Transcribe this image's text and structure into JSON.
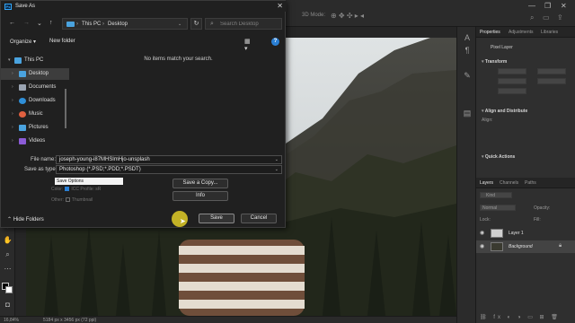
{
  "dialog": {
    "title": "Save As",
    "close_glyph": "✕",
    "nav": {
      "back": "←",
      "forward": "→",
      "recent": "⌄",
      "up": "↑",
      "refresh": "↻"
    },
    "breadcrumb": [
      "This PC",
      "Desktop"
    ],
    "breadcrumb_sep": "›",
    "search_placeholder": "Search Desktop",
    "toolbar": {
      "organize": "Organize ▾",
      "new_folder": "New folder",
      "view_glyph": "▦ ▾",
      "help_glyph": "?"
    },
    "tree": [
      {
        "label": "This PC",
        "expanded": true,
        "color": "#4aa3df"
      },
      {
        "label": "Desktop",
        "selected": true,
        "color": "#4aa3df"
      },
      {
        "label": "Documents",
        "color": "#9aa4b2"
      },
      {
        "label": "Downloads",
        "color": "#2f8fd8"
      },
      {
        "label": "Music",
        "color": "#e06040"
      },
      {
        "label": "Pictures",
        "color": "#4aa3df"
      },
      {
        "label": "Videos",
        "color": "#8b5bd6"
      }
    ],
    "empty_message": "No items match your search.",
    "file_name_label": "File name:",
    "file_name_value": "joseph-young-i87MHSlmHjo-unsplash",
    "save_as_type_label": "Save as type:",
    "save_as_type_value": "Photoshop (*.PSD;*.PDD;*.PSDT)",
    "save_options_title": "Save Options",
    "color_label": "Color:",
    "icc_label": "ICC Profile: sR",
    "other_label": "Other:",
    "thumbnail_label": "Thumbnail",
    "save_copy_button": "Save a Copy...",
    "info_button": "Info",
    "hide_folders": "Hide Folders",
    "save_button": "Save",
    "cancel_button": "Cancel"
  },
  "photoshop": {
    "window_controls": [
      "—",
      "❐",
      "✕"
    ],
    "options_mode": "3D Mode:",
    "status_zoom": "16,84%",
    "status_doc": "5184 px x 3456 px (72 ppi)",
    "panel_tabs": [
      "Properties",
      "Adjustments",
      "Libraries"
    ],
    "pixel_layer": "Pixel Layer",
    "transform_title": "Transform",
    "align_title": "Align and Distribute",
    "align_label": "Align:",
    "quick_actions_title": "Quick Actions",
    "layers_tabs": [
      "Layers",
      "Channels",
      "Paths"
    ],
    "kind_filter": "Kind",
    "blend_mode": "Normal",
    "opacity_label": "Opacity:",
    "lock_label": "Lock:",
    "fill_label": "Fill:",
    "layers": [
      {
        "name": "Layer 1",
        "selected": false
      },
      {
        "name": "Background",
        "selected": true
      }
    ]
  }
}
